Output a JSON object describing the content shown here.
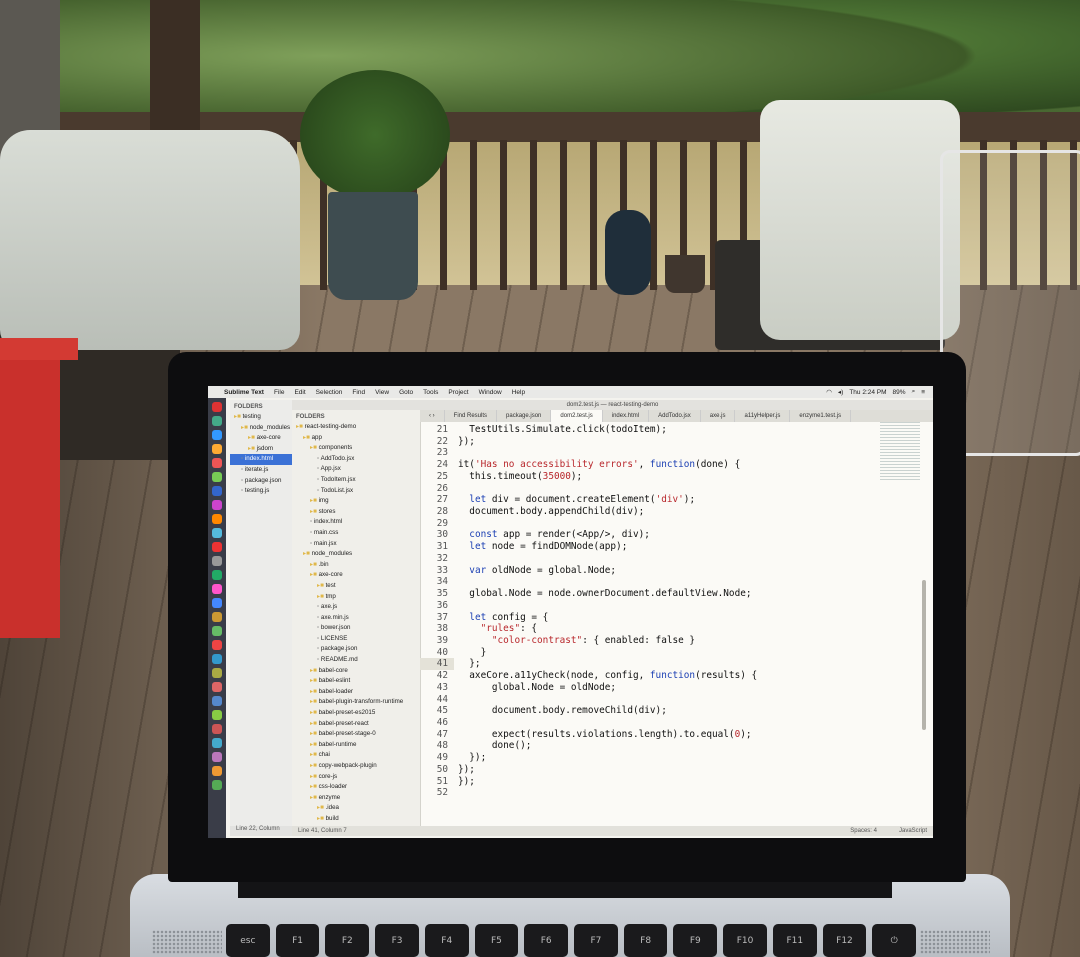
{
  "menubar": {
    "apple": "",
    "app_name": "Sublime Text",
    "items": [
      "File",
      "Edit",
      "Selection",
      "Find",
      "View",
      "Goto",
      "Tools",
      "Project",
      "Window",
      "Help"
    ],
    "clock": "Thu 2:24 PM",
    "battery": "89%"
  },
  "back_window": {
    "sidebar_label": "FOLDERS",
    "tree": [
      "testing",
      "node_modules",
      "axe-core",
      "jsdom",
      "index.html",
      "iterate.js",
      "package.json",
      "testing.js"
    ],
    "selected_index": 4,
    "status": "Line 22, Column"
  },
  "front_window": {
    "title": "dom2.test.js — react-testing-demo",
    "sidebar_label": "FOLDERS",
    "tree": [
      "react-testing-demo",
      "app",
      "components",
      "AddTodo.jsx",
      "App.jsx",
      "TodoItem.jsx",
      "TodoList.jsx",
      "img",
      "stores",
      "index.html",
      "main.css",
      "main.jsx",
      "node_modules",
      ".bin",
      "axe-core",
      "test",
      "tmp",
      "axe.js",
      "axe.min.js",
      "bower.json",
      "LICENSE",
      "package.json",
      "README.md",
      "babel-core",
      "babel-eslint",
      "babel-loader",
      "babel-plugin-transform-runtime",
      "babel-preset-es2015",
      "babel-preset-react",
      "babel-preset-stage-0",
      "babel-runtime",
      "chai",
      "copy-webpack-plugin",
      "core-js",
      "css-loader",
      "enzyme",
      ".idea",
      "build"
    ],
    "tabs": [
      "Find Results",
      "package.json",
      "dom2.test.js",
      "index.html",
      "AddTodo.jsx",
      "axe.js",
      "a11yHelper.js",
      "enzyme1.test.js"
    ],
    "active_tab": 2,
    "line_numbers": [
      "21",
      "22",
      "23",
      "24",
      "25",
      "26",
      "27",
      "28",
      "29",
      "30",
      "31",
      "32",
      "33",
      "34",
      "35",
      "36",
      "37",
      "38",
      "39",
      "40",
      "41",
      "42",
      "43",
      "44",
      "45",
      "46",
      "47",
      "48",
      "49",
      "50",
      "51",
      "52"
    ],
    "current_line": "41",
    "code_lines": [
      "  TestUtils.Simulate.click(todoItem);",
      "});",
      "",
      "it('Has no accessibility errors', function(done) {",
      "  this.timeout(35000);",
      "",
      "  let div = document.createElement('div');",
      "  document.body.appendChild(div);",
      "",
      "  const app = render(<App/>, div);",
      "  let node = findDOMNode(app);",
      "",
      "  var oldNode = global.Node;",
      "",
      "  global.Node = node.ownerDocument.defaultView.Node;",
      "",
      "  let config = {",
      "    \"rules\": {",
      "      \"color-contrast\": { enabled: false }",
      "    }",
      "  };",
      "  axeCore.a11yCheck(node, config, function(results) {",
      "      global.Node = oldNode;",
      "",
      "      document.body.removeChild(div);",
      "",
      "      expect(results.violations.length).to.equal(0);",
      "      done();",
      "  });",
      "});",
      "});",
      ""
    ],
    "status_left": "Line 41, Column 7",
    "spaces": "Spaces: 4",
    "syntax": "JavaScript"
  },
  "keyboard": [
    "esc",
    "F1",
    "F2",
    "F3",
    "F4",
    "F5",
    "F6",
    "F7",
    "F8",
    "F9",
    "F10",
    "F11",
    "F12",
    "⏻"
  ],
  "colors": {
    "selection": "#3b71d6",
    "folder": "#e0b84a"
  }
}
